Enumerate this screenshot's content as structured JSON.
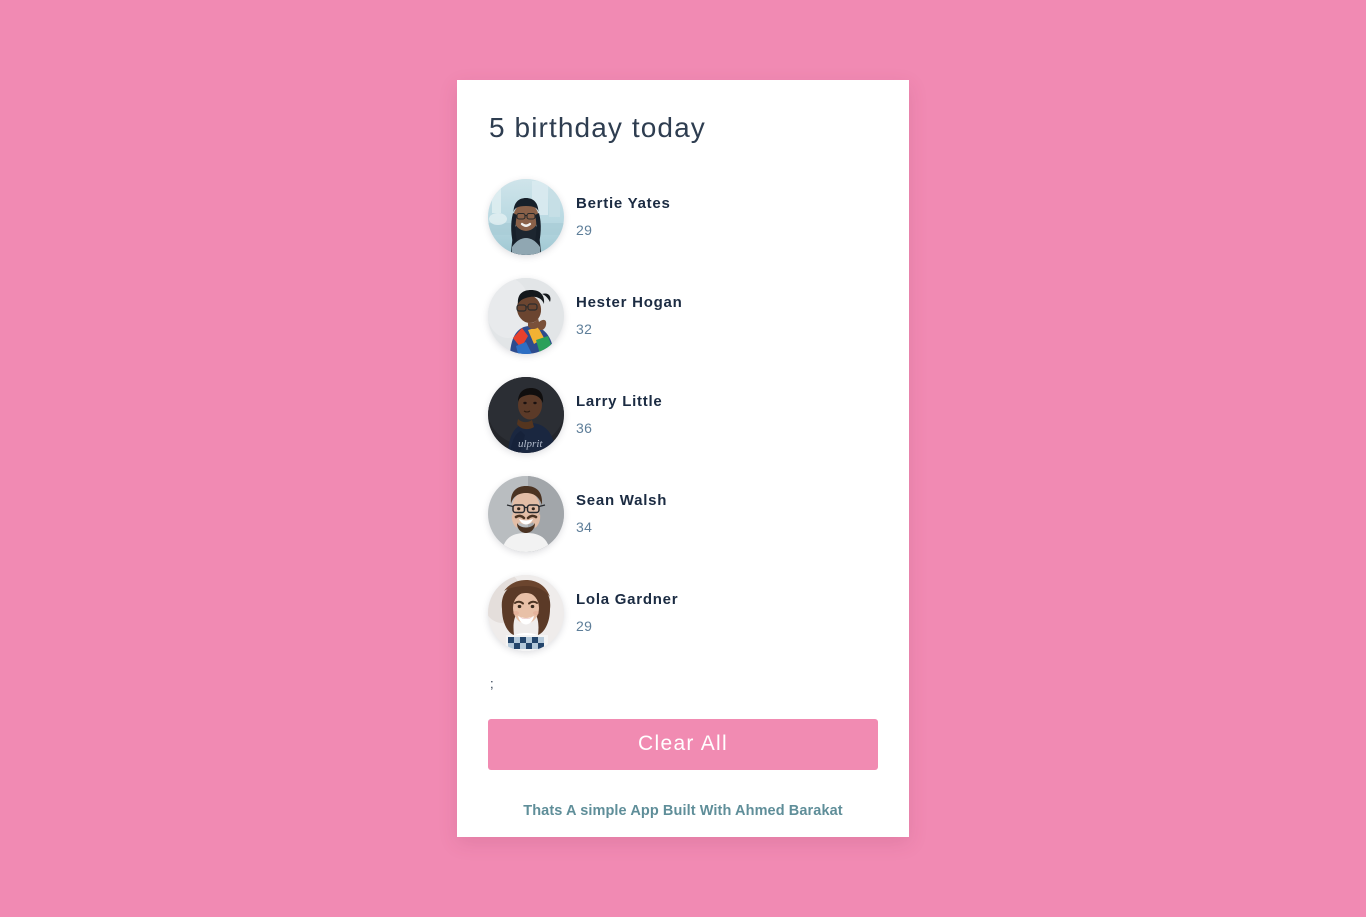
{
  "page": {
    "background_color": "#f18ab3",
    "card_background": "#ffffff"
  },
  "card": {
    "title": "5 birthday today",
    "stray_text": ";",
    "people": [
      {
        "name": "Bertie Yates",
        "age": "29",
        "avatar": "woman-glasses-city-avatar"
      },
      {
        "name": "Hester Hogan",
        "age": "32",
        "avatar": "woman-floral-top-avatar"
      },
      {
        "name": "Larry Little",
        "age": "36",
        "avatar": "man-dark-shirt-avatar"
      },
      {
        "name": "Sean Walsh",
        "age": "34",
        "avatar": "man-glasses-beard-avatar"
      },
      {
        "name": "Lola Gardner",
        "age": "29",
        "avatar": "woman-curly-hair-avatar"
      }
    ],
    "clear_button_label": "Clear All",
    "footer_note": "Thats A simple App Built With Ahmed Barakat"
  },
  "colors": {
    "accent_pink": "#f18bb2",
    "title_navy": "#2e3d50",
    "name_navy": "#1b2b42",
    "age_slate": "#5e7e99",
    "footer_teal": "#5f8e99"
  }
}
